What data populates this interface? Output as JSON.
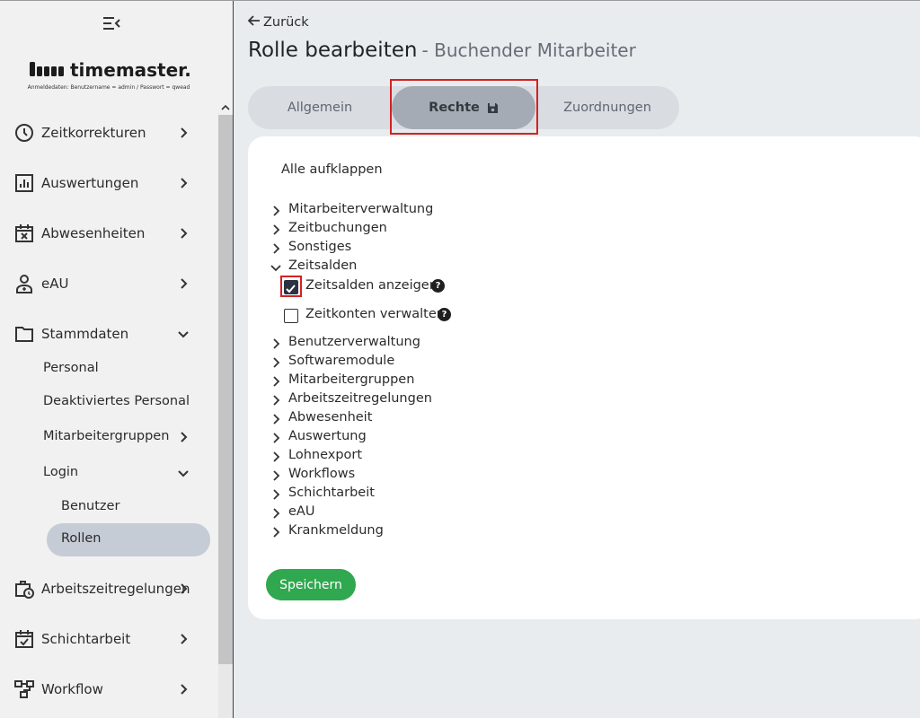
{
  "brand": {
    "name": "timemaster.",
    "note": "Anmeldedaten: Benutzername = admin / Passwort = qwead"
  },
  "sidebar": {
    "items": [
      {
        "label": "Zeitkorrekturen",
        "icon": "clock-icon"
      },
      {
        "label": "Auswertungen",
        "icon": "bar-chart-icon"
      },
      {
        "label": "Abwesenheiten",
        "icon": "calendar-x-icon"
      },
      {
        "label": "eAU",
        "icon": "person-medical-icon"
      },
      {
        "label": "Stammdaten",
        "icon": "folder-icon",
        "expanded": true
      },
      {
        "label": "Arbeitszeitregelungen",
        "icon": "briefcase-clock-icon"
      },
      {
        "label": "Schichtarbeit",
        "icon": "calendar-check-icon"
      },
      {
        "label": "Workflow",
        "icon": "workflow-icon"
      }
    ],
    "stammdaten_sub": [
      {
        "label": "Personal"
      },
      {
        "label": "Deaktiviertes Personal"
      },
      {
        "label": "Mitarbeitergruppen"
      },
      {
        "label": "Login"
      }
    ],
    "login_sub": [
      {
        "label": "Benutzer"
      },
      {
        "label": "Rollen",
        "active": true
      }
    ]
  },
  "header": {
    "back_label": "Zurück",
    "title": "Rolle bearbeiten",
    "subtitle": "- Buchender Mitarbeiter"
  },
  "tabs": [
    {
      "label": "Allgemein"
    },
    {
      "label": "Rechte",
      "active": true
    },
    {
      "label": "Zuordnungen"
    }
  ],
  "rights": {
    "expand_all_label": "Alle aufklappen",
    "groups_before": [
      "Mitarbeiterverwaltung",
      "Zeitbuchungen",
      "Sonstiges"
    ],
    "expanded_group": {
      "label": "Zeitsalden",
      "permissions": [
        {
          "label": "Zeitsalden anzeigen",
          "checked": true
        },
        {
          "label": "Zeitkonten verwalten",
          "checked": false
        }
      ]
    },
    "groups_after": [
      "Benutzerverwaltung",
      "Softwaremodule",
      "Mitarbeitergruppen",
      "Arbeitszeitregelungen",
      "Abwesenheit",
      "Auswertung",
      "Lohnexport",
      "Workflows",
      "Schichtarbeit",
      "eAU",
      "Krankmeldung"
    ],
    "save_label": "Speichern"
  },
  "colors": {
    "accent": "#2fa84f",
    "highlight": "#d42121",
    "active_tab": "#a4abb4",
    "active_nav": "#c6ccd5"
  }
}
